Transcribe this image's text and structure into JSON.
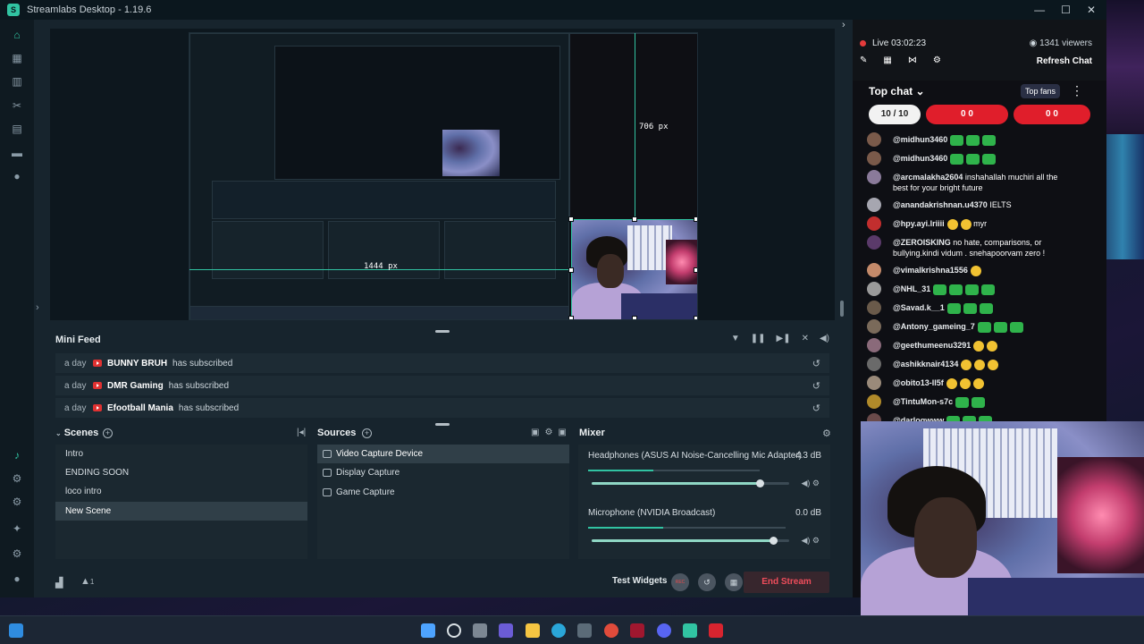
{
  "window": {
    "title": "Streamlabs Desktop - 1.19.6",
    "minimize": "—",
    "maximize": "☐",
    "close": "✕"
  },
  "preview": {
    "width_label": "1444 px",
    "height_label": "706 px"
  },
  "minifeed": {
    "title": "Mini Feed",
    "rows": [
      {
        "when": "a day",
        "name": "BUNNY BRUH",
        "action": "has subscribed"
      },
      {
        "when": "a day",
        "name": "DMR Gaming",
        "action": "has subscribed"
      },
      {
        "when": "a day",
        "name": "Efootball Mania",
        "action": "has subscribed"
      }
    ]
  },
  "scenes": {
    "title": "Scenes",
    "items": [
      "Intro",
      "ENDING SOON",
      "loco intro",
      "New Scene"
    ],
    "selected": "New Scene"
  },
  "sources": {
    "title": "Sources",
    "items": [
      "Video Capture Device",
      "Display Capture",
      "Game Capture"
    ],
    "selected": "Video Capture Device"
  },
  "mixer": {
    "title": "Mixer",
    "channels": [
      {
        "name": "Headphones (ASUS AI Noise-Cancelling Mic Adapter)",
        "db": "-4.3 dB",
        "level": 0.38,
        "volume": 0.85
      },
      {
        "name": "Microphone (NVIDIA Broadcast)",
        "db": "0.0 dB",
        "level": 0.38,
        "volume": 0.92
      }
    ]
  },
  "footer": {
    "test_widgets": "Test Widgets",
    "rec": "REC",
    "end_stream": "End Stream",
    "alert_count": "1"
  },
  "chat": {
    "live_label": "Live 03:02:23",
    "viewers": "1341 viewers",
    "refresh": "Refresh Chat",
    "mode": "Top chat",
    "top_fans": "Top fans",
    "pill1": "10 / 10",
    "pill2": "0  0",
    "pill3": "0  0",
    "messages": [
      {
        "user": "@midhun3460",
        "text": "",
        "emotes": 3,
        "smileys": 0
      },
      {
        "user": "@midhun3460",
        "text": "",
        "emotes": 3,
        "smileys": 0
      },
      {
        "user": "@arcmalakha2604",
        "text": "inshahallah muchiri all the best for your bright future",
        "emotes": 0,
        "smileys": 0
      },
      {
        "user": "@anandakrishnan.u4370",
        "text": "IELTS",
        "emotes": 0,
        "smileys": 0
      },
      {
        "user": "@hpy.ayi.lriiii",
        "text": "myr",
        "emotes": 0,
        "smileys": 2
      },
      {
        "user": "@ZEROISKING",
        "text": "no hate, comparisons, or bullying.kindi vidum . snehapoorvam zero !",
        "emotes": 0,
        "smileys": 0
      },
      {
        "user": "@vimalkrishna1556",
        "text": "",
        "emotes": 0,
        "smileys": 1
      },
      {
        "user": "@NHL_31",
        "text": "",
        "emotes": 4,
        "smileys": 0
      },
      {
        "user": "@Savad.k__1",
        "text": "",
        "emotes": 3,
        "smileys": 0
      },
      {
        "user": "@Antony_gameing_7",
        "text": "",
        "emotes": 3,
        "smileys": 0
      },
      {
        "user": "@geethumeenu3291",
        "text": "",
        "emotes": 0,
        "smileys": 2
      },
      {
        "user": "@ashikknair4134",
        "text": "",
        "emotes": 0,
        "smileys": 3
      },
      {
        "user": "@obito13-ll5f",
        "text": "",
        "emotes": 0,
        "smileys": 3
      },
      {
        "user": "@TintuMon-s7c",
        "text": "",
        "emotes": 2,
        "smileys": 0
      },
      {
        "user": "@darlogwww",
        "text": "",
        "emotes": 3,
        "smileys": 0
      }
    ]
  },
  "colors": {
    "accent": "#31c3a2",
    "live": "#e43b3b",
    "end_stream": "#ef4d5b",
    "pill_red": "#e01e2b"
  },
  "icons": [
    "studio-icon",
    "layout-icon",
    "dashboard-icon",
    "themes-icon",
    "store-icon",
    "highlighter-icon",
    "record-icon",
    "tiktok-icon",
    "settings-icon",
    "profile-icon"
  ]
}
